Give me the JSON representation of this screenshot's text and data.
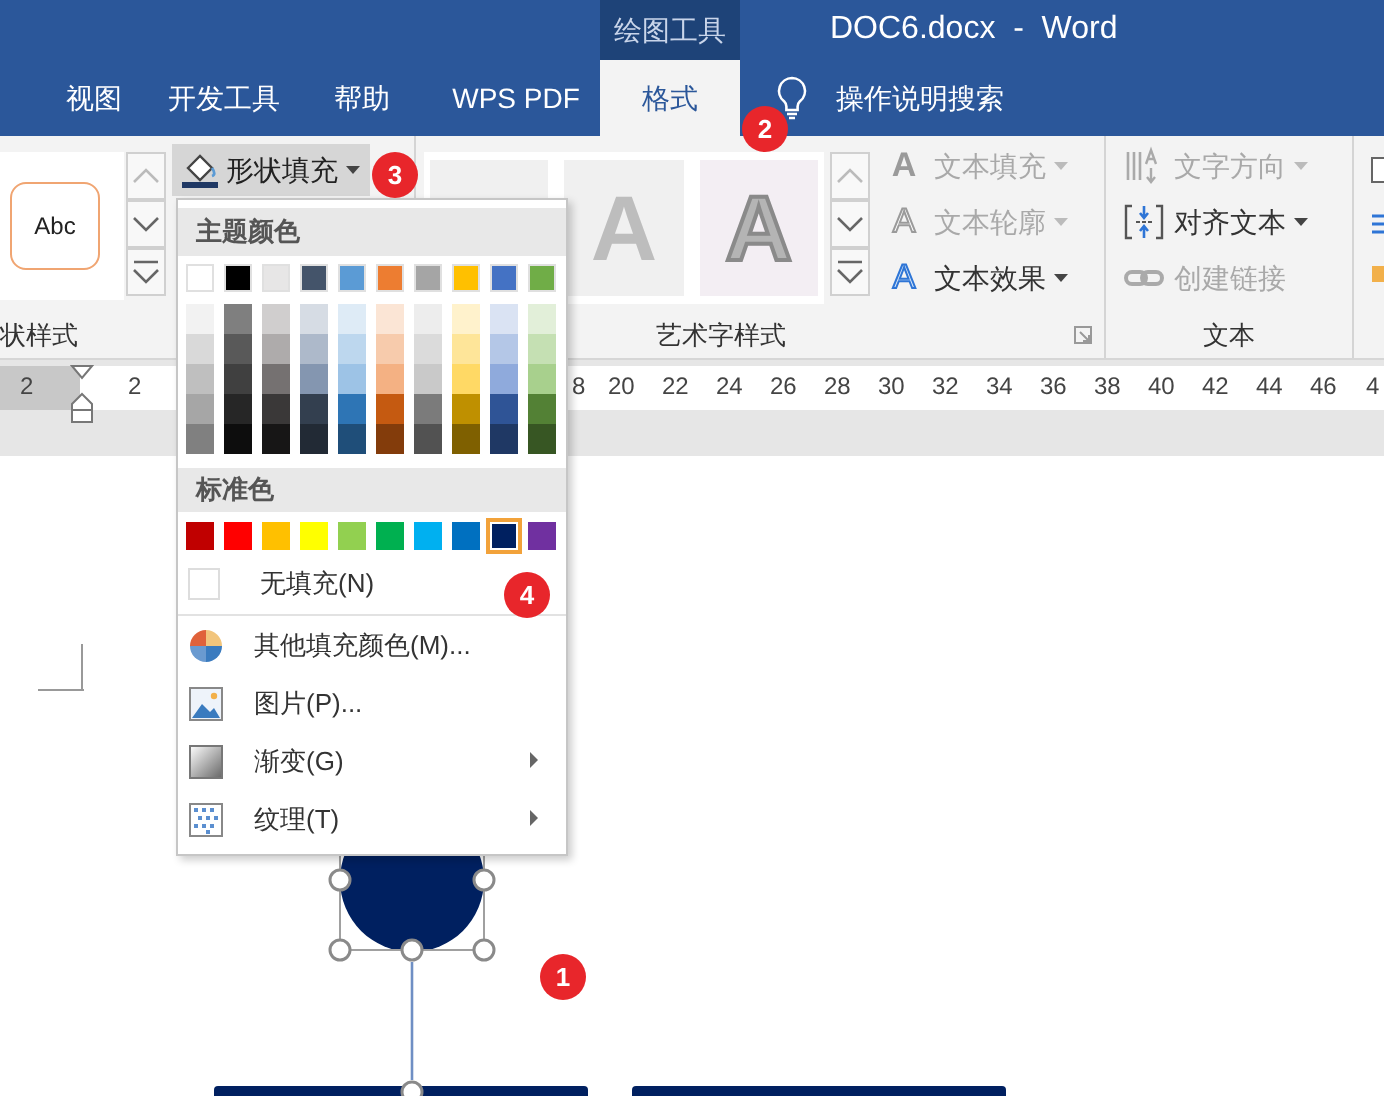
{
  "title_bar": {
    "contextual_tab": "绘图工具",
    "title": "DOC6.docx  -  Word"
  },
  "ribbon_tabs": [
    {
      "label": "视图",
      "selected": false
    },
    {
      "label": "开发工具",
      "selected": false
    },
    {
      "label": "帮助",
      "selected": false
    },
    {
      "label": "WPS PDF",
      "selected": false
    },
    {
      "label": "格式",
      "selected": true
    }
  ],
  "tell_me": {
    "label": "操作说明搜索"
  },
  "ribbon": {
    "shape_styles": {
      "label": "状样式",
      "preview": "Abc",
      "shape_fill": {
        "label": "形状填充",
        "expanded": true
      }
    },
    "wordart_styles": {
      "label": "艺术字样式",
      "gallery": [
        {
          "kind": "plain"
        },
        {
          "kind": "fill",
          "sample": "A"
        },
        {
          "kind": "outline",
          "sample": "A"
        }
      ],
      "commands": [
        {
          "kind": "fill",
          "icon": "A",
          "label": "文本填充",
          "disabled": true
        },
        {
          "kind": "outline",
          "icon": "A",
          "label": "文本轮廓",
          "disabled": true
        },
        {
          "kind": "effects",
          "icon": "A",
          "label": "文本效果",
          "disabled": false
        }
      ]
    },
    "text": {
      "label": "文本",
      "commands": [
        {
          "kind": "direction",
          "label": "文字方向",
          "disabled": true,
          "dropdown": true
        },
        {
          "kind": "align",
          "label": "对齐文本",
          "disabled": false,
          "dropdown": true
        },
        {
          "kind": "link",
          "label": "创建链接",
          "disabled": true,
          "dropdown": false
        }
      ]
    }
  },
  "ruler": {
    "labels": [
      "2",
      "2",
      "8",
      "20",
      "22",
      "24",
      "26",
      "28",
      "30",
      "32",
      "34",
      "36",
      "38",
      "40",
      "42",
      "44",
      "46",
      "4"
    ]
  },
  "fill_menu": {
    "theme_header": "主题颜色",
    "theme_colors": [
      {
        "color": "#ffffff",
        "shades": [
          {
            "color": "#f2f2f2"
          },
          {
            "color": "#d9d9d9"
          },
          {
            "color": "#bfbfbf"
          },
          {
            "color": "#a6a6a6"
          },
          {
            "color": "#808080"
          }
        ]
      },
      {
        "color": "#000000",
        "shades": [
          {
            "color": "#7f7f7f"
          },
          {
            "color": "#595959"
          },
          {
            "color": "#404040"
          },
          {
            "color": "#262626"
          },
          {
            "color": "#0d0d0d"
          }
        ]
      },
      {
        "color": "#e7e6e6",
        "shades": [
          {
            "color": "#d0cece"
          },
          {
            "color": "#aeabab"
          },
          {
            "color": "#757171"
          },
          {
            "color": "#3a3838"
          },
          {
            "color": "#171616"
          }
        ]
      },
      {
        "color": "#44546a",
        "shades": [
          {
            "color": "#d6dce4"
          },
          {
            "color": "#adb9ca"
          },
          {
            "color": "#8496b0"
          },
          {
            "color": "#333f4f"
          },
          {
            "color": "#222a35"
          }
        ]
      },
      {
        "color": "#5b9bd5",
        "shades": [
          {
            "color": "#deebf6"
          },
          {
            "color": "#bdd7ee"
          },
          {
            "color": "#9dc3e6"
          },
          {
            "color": "#2e75b5"
          },
          {
            "color": "#1f4e79"
          }
        ]
      },
      {
        "color": "#ed7d31",
        "shades": [
          {
            "color": "#fbe5d5"
          },
          {
            "color": "#f7cbac"
          },
          {
            "color": "#f4b183"
          },
          {
            "color": "#c55a11"
          },
          {
            "color": "#833c0b"
          }
        ]
      },
      {
        "color": "#a5a5a5",
        "shades": [
          {
            "color": "#ededed"
          },
          {
            "color": "#dbdbdb"
          },
          {
            "color": "#c9c9c9"
          },
          {
            "color": "#7b7b7b"
          },
          {
            "color": "#525252"
          }
        ]
      },
      {
        "color": "#ffc000",
        "shades": [
          {
            "color": "#fff2cc"
          },
          {
            "color": "#fee599"
          },
          {
            "color": "#ffd965"
          },
          {
            "color": "#bf9000"
          },
          {
            "color": "#7f6000"
          }
        ]
      },
      {
        "color": "#4472c4",
        "shades": [
          {
            "color": "#dae3f3"
          },
          {
            "color": "#b4c7e7"
          },
          {
            "color": "#8faadc"
          },
          {
            "color": "#2f5496"
          },
          {
            "color": "#1f3864"
          }
        ]
      },
      {
        "color": "#70ad47",
        "shades": [
          {
            "color": "#e2efd9"
          },
          {
            "color": "#c5e0b3"
          },
          {
            "color": "#a8d08d"
          },
          {
            "color": "#538135"
          },
          {
            "color": "#375623"
          }
        ]
      }
    ],
    "standard_header": "标准色",
    "standard_colors": [
      {
        "color": "#c00000",
        "selected": false
      },
      {
        "color": "#ff0000",
        "selected": false
      },
      {
        "color": "#ffc000",
        "selected": false
      },
      {
        "color": "#ffff00",
        "selected": false
      },
      {
        "color": "#92d050",
        "selected": false
      },
      {
        "color": "#00b050",
        "selected": false
      },
      {
        "color": "#00b0f0",
        "selected": false
      },
      {
        "color": "#0070c0",
        "selected": false
      },
      {
        "color": "#002060",
        "selected": true
      },
      {
        "color": "#7030a0",
        "selected": false
      }
    ],
    "no_fill": "无填充(N)",
    "items": [
      {
        "kind": "more_colors",
        "label": "其他填充颜色(M)...",
        "submenu": false
      },
      {
        "kind": "picture",
        "label": "图片(P)...",
        "submenu": false
      },
      {
        "kind": "gradient",
        "label": "渐变(G)",
        "submenu": true
      },
      {
        "kind": "texture",
        "label": "纹理(T)",
        "submenu": true
      }
    ]
  },
  "callouts": [
    {
      "number": "2"
    },
    {
      "number": "3"
    },
    {
      "number": "4"
    },
    {
      "number": "1"
    }
  ]
}
